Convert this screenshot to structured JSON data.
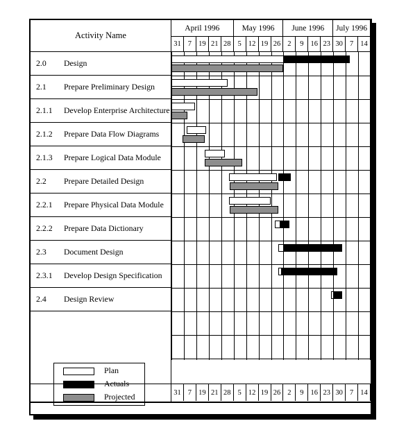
{
  "chart_data": {
    "type": "bar",
    "title": "Gantt Chart",
    "xlabel": "",
    "ylabel": "Activity Name",
    "grid": true,
    "legend_position": "bottom-left",
    "columns": {
      "activity_header": "Activity Name",
      "months": [
        {
          "label": "April 1996",
          "span": 5
        },
        {
          "label": "May  1996",
          "span": 4
        },
        {
          "label": "June  1996",
          "span": 4
        },
        {
          "label": "July  1996",
          "span": 3
        }
      ],
      "days": [
        "31",
        "7",
        "19",
        "21",
        "28",
        "5",
        "12",
        "19",
        "26",
        "2",
        "9",
        "16",
        "23",
        "30",
        "7",
        "14"
      ],
      "days_footer": [
        "31",
        "7",
        "19",
        "21",
        "28",
        "5",
        "12",
        "19",
        "26",
        "2",
        "9",
        "16",
        "23",
        "30",
        "7",
        "14"
      ]
    },
    "legend": [
      {
        "key": "plan",
        "label": "Plan",
        "color": "#ffffff"
      },
      {
        "key": "actuals",
        "label": "Actuals",
        "color": "#000000"
      },
      {
        "key": "projected",
        "label": "Projected",
        "color": "#8d8d8d"
      }
    ],
    "rows": [
      {
        "number": "2.0",
        "name": "Design",
        "bars": [
          {
            "type": "plan",
            "start": 0.0,
            "end": 13.6
          },
          {
            "type": "projected",
            "start": 0.0,
            "end": 9.0
          },
          {
            "type": "actuals",
            "start": 9.0,
            "end": 14.3
          }
        ]
      },
      {
        "number": "2.1",
        "name": "Prepare Preliminary Design",
        "bars": [
          {
            "type": "plan",
            "start": 0.0,
            "end": 4.5
          },
          {
            "type": "projected",
            "start": 0.0,
            "end": 6.9
          }
        ]
      },
      {
        "number": "2.1.1",
        "name": "Develop Enterprise Architecture",
        "bars": [
          {
            "type": "plan",
            "start": 0.0,
            "end": 1.9
          },
          {
            "type": "projected",
            "start": 0.0,
            "end": 1.3
          }
        ]
      },
      {
        "number": "2.1.2",
        "name": "Prepare Data Flow Diagrams",
        "bars": [
          {
            "type": "plan",
            "start": 1.2,
            "end": 2.8
          },
          {
            "type": "projected",
            "start": 0.9,
            "end": 2.7
          }
        ]
      },
      {
        "number": "2.1.3",
        "name": "Prepare Logical Data Module",
        "bars": [
          {
            "type": "plan",
            "start": 2.7,
            "end": 4.3
          },
          {
            "type": "projected",
            "start": 2.7,
            "end": 5.7
          }
        ]
      },
      {
        "number": "2.2",
        "name": "Prepare Detailed Design",
        "bars": [
          {
            "type": "plan",
            "start": 4.6,
            "end": 8.5
          },
          {
            "type": "actuals",
            "start": 8.6,
            "end": 9.6
          },
          {
            "type": "projected",
            "start": 4.7,
            "end": 8.6
          }
        ]
      },
      {
        "number": "2.2.1",
        "name": "Prepare Physical Data Module",
        "bars": [
          {
            "type": "plan",
            "start": 4.6,
            "end": 8.0
          },
          {
            "type": "projected",
            "start": 4.7,
            "end": 8.6
          }
        ]
      },
      {
        "number": "2.2.2",
        "name": "Prepare Data Dictionary",
        "bars": [
          {
            "type": "plan",
            "start": 8.3,
            "end": 9.1
          },
          {
            "type": "actuals",
            "start": 8.7,
            "end": 9.5
          }
        ]
      },
      {
        "number": "2.3",
        "name": "Document Design",
        "bars": [
          {
            "type": "plan",
            "start": 8.6,
            "end": 12.8
          },
          {
            "type": "actuals",
            "start": 9.0,
            "end": 13.7
          }
        ]
      },
      {
        "number": "2.3.1",
        "name": "Develop Design Specification",
        "bars": [
          {
            "type": "plan",
            "start": 8.6,
            "end": 12.8
          },
          {
            "type": "actuals",
            "start": 8.8,
            "end": 13.3
          }
        ]
      },
      {
        "number": "2.4",
        "name": "Design Review",
        "bars": [
          {
            "type": "plan",
            "start": 12.8,
            "end": 13.4
          },
          {
            "type": "actuals",
            "start": 13.0,
            "end": 13.7
          }
        ]
      },
      {
        "number": "",
        "name": "",
        "bars": []
      }
    ]
  }
}
